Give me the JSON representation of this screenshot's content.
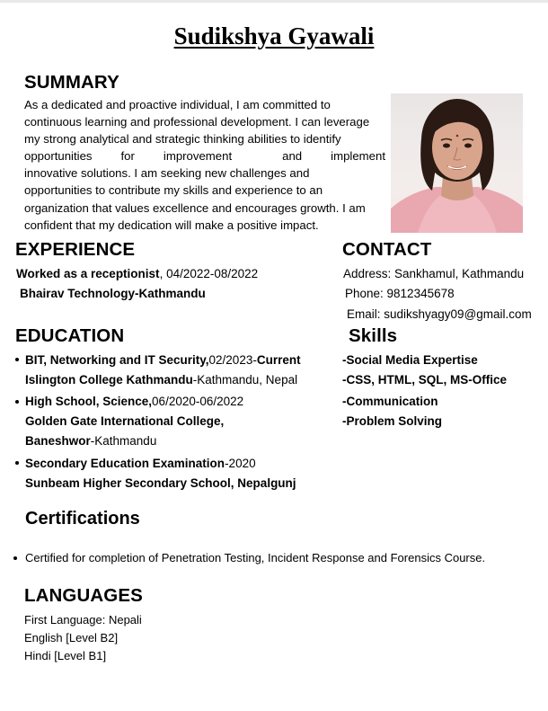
{
  "name": "Sudikshya Gyawali",
  "summary": {
    "title": "SUMMARY",
    "lines": [
      "As a dedicated and proactive individual, I am committed to",
      "continuous learning and professional development. I can leverage",
      "my strong analytical and strategic thinking abilities to identify",
      [
        "opportunities",
        "for",
        "improvement",
        "and",
        "implement"
      ],
      "innovative solutions. I am seeking new challenges and",
      "opportunities to contribute my skills and experience to an",
      "organization that values excellence and encourages growth. I am",
      "confident that my dedication will make a positive impact."
    ]
  },
  "photo": {
    "alt": "profile-photo"
  },
  "experience": {
    "title": "EXPERIENCE",
    "role": "Worked as a receptionist",
    "dates": ", 04/2022-08/2022",
    "company": "Bhairav Technology-Kathmandu"
  },
  "contact": {
    "title": "CONTACT",
    "address": "Address: Sankhamul, Kathmandu",
    "phone": "Phone: 9812345678",
    "email": "Email: sudikshyagy09@gmail.com"
  },
  "education": {
    "title": "EDUCATION",
    "items": [
      {
        "degree": "BIT, Networking and IT Security,",
        "dates": "02/2023-",
        "status": "Current",
        "school": "Islington College Kathmandu",
        "location": "-Kathmandu, Nepal"
      },
      {
        "degree": "High School, Science,",
        "dates": "06/2020-06/2022",
        "school_line1": "Golden Gate International College,",
        "school_line2": "Baneshwor",
        "location": "-Kathmandu"
      },
      {
        "degree": "Secondary Education Examination",
        "dates": "-2020",
        "school": "Sunbeam Higher Secondary School, Nepalgunj"
      }
    ]
  },
  "skills": {
    "title": "Skills",
    "items": [
      "-Social Media Expertise",
      "-CSS, HTML, SQL, MS-Office",
      "-Communication",
      "-Problem Solving"
    ]
  },
  "certifications": {
    "title": "Certifications",
    "items": [
      "Certified for completion of Penetration Testing, Incident Response and Forensics Course."
    ]
  },
  "languages": {
    "title": "LANGUAGES",
    "items": [
      "First Language: Nepali",
      "English [Level B2]",
      "Hindi [Level B1]"
    ]
  }
}
